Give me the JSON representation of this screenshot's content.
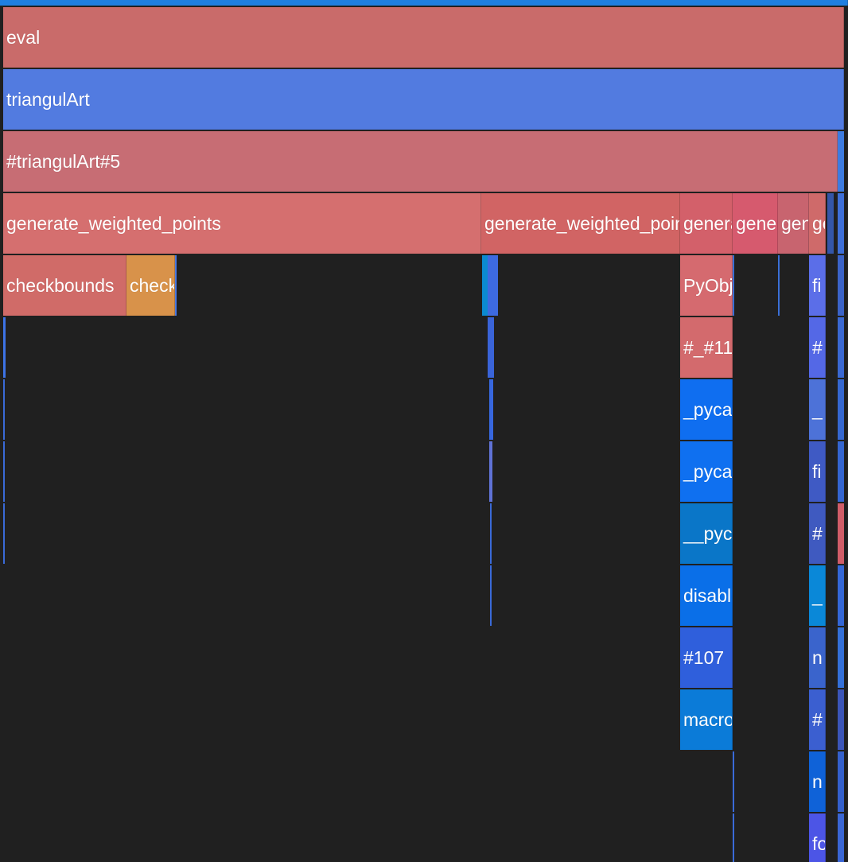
{
  "flamegraph": {
    "rows": [
      {
        "frames": [
          {
            "label": "",
            "start": 0,
            "end": 1066,
            "color": "#1f7fe0"
          }
        ]
      },
      {
        "frames": [
          {
            "label": "eval",
            "start": 4,
            "end": 1061,
            "color": "#c96b6a"
          }
        ]
      },
      {
        "frames": [
          {
            "label": "triangulArt",
            "start": 4,
            "end": 1061,
            "color": "#527be0"
          }
        ]
      },
      {
        "frames": [
          {
            "label": "#triangulArt#5",
            "start": 4,
            "end": 1053,
            "color": "#c76d74"
          },
          {
            "label": "",
            "start": 1053,
            "end": 1061,
            "color": "#3d7be0"
          }
        ]
      },
      {
        "frames": [
          {
            "label": "generate_weighted_points",
            "start": 4,
            "end": 605,
            "color": "#d56f6f"
          },
          {
            "label": "generate_weighted_points",
            "start": 605,
            "end": 855,
            "color": "#d16464"
          },
          {
            "label": "generate_weighted_points",
            "start": 855,
            "end": 921,
            "color": "#d3606a"
          },
          {
            "label": "generate_weighted_points",
            "start": 921,
            "end": 978,
            "color": "#d65a6e"
          },
          {
            "label": "generate_weighted_points",
            "start": 978,
            "end": 1017,
            "color": "#c8646f"
          },
          {
            "label": "generate_weighted_points",
            "start": 1017,
            "end": 1038,
            "color": "#cf6a6a"
          },
          {
            "label": "",
            "start": 1040,
            "end": 1048,
            "color": "#3456a8"
          },
          {
            "label": "",
            "start": 1053,
            "end": 1061,
            "color": "#3e6fd8"
          }
        ]
      },
      {
        "frames": [
          {
            "label": "checkbounds",
            "start": 4,
            "end": 159,
            "color": "#d06b68"
          },
          {
            "label": "checkbounds",
            "start": 159,
            "end": 220,
            "color": "#d8924a"
          },
          {
            "label": "",
            "start": 220,
            "end": 222,
            "color": "#4a78e0"
          },
          {
            "label": "",
            "start": 606,
            "end": 613,
            "color": "#0b8ad0"
          },
          {
            "label": "",
            "start": 613,
            "end": 626,
            "color": "#3d6ae0"
          },
          {
            "label": "PyObject",
            "start": 855,
            "end": 921,
            "color": "#d56a6f"
          },
          {
            "label": "",
            "start": 921,
            "end": 923,
            "color": "#3a6fd6"
          },
          {
            "label": "",
            "start": 978,
            "end": 980,
            "color": "#3a6fd6"
          },
          {
            "label": "fi",
            "start": 1017,
            "end": 1038,
            "color": "#5b6ee8"
          },
          {
            "label": "",
            "start": 1053,
            "end": 1061,
            "color": "#3b63c8"
          }
        ]
      },
      {
        "frames": [
          {
            "label": "",
            "start": 4,
            "end": 7,
            "color": "#3d73e6"
          },
          {
            "label": "",
            "start": 613,
            "end": 621,
            "color": "#3a64d8"
          },
          {
            "label": "#_#11",
            "start": 855,
            "end": 921,
            "color": "#d36a6d"
          },
          {
            "label": "#",
            "start": 1017,
            "end": 1038,
            "color": "#5468e6"
          },
          {
            "label": "",
            "start": 1053,
            "end": 1061,
            "color": "#3a68d2"
          }
        ]
      },
      {
        "frames": [
          {
            "label": "",
            "start": 4,
            "end": 6,
            "color": "#3a6ad8"
          },
          {
            "label": "",
            "start": 615,
            "end": 620,
            "color": "#3767de"
          },
          {
            "label": "_pycall",
            "start": 855,
            "end": 921,
            "color": "#0f6ef0"
          },
          {
            "label": "_",
            "start": 1017,
            "end": 1038,
            "color": "#4d72d8"
          },
          {
            "label": "",
            "start": 1053,
            "end": 1061,
            "color": "#3567d0"
          }
        ]
      },
      {
        "frames": [
          {
            "label": "",
            "start": 4,
            "end": 6,
            "color": "#3a6ad8"
          },
          {
            "label": "",
            "start": 615,
            "end": 619,
            "color": "#5f72d6"
          },
          {
            "label": "_pycall",
            "start": 855,
            "end": 921,
            "color": "#0f70f0"
          },
          {
            "label": "fi",
            "start": 1017,
            "end": 1038,
            "color": "#3f5ac4"
          },
          {
            "label": "",
            "start": 1053,
            "end": 1061,
            "color": "#3465d0"
          }
        ]
      },
      {
        "frames": [
          {
            "label": "",
            "start": 4,
            "end": 6,
            "color": "#3a6ad8"
          },
          {
            "label": "",
            "start": 616,
            "end": 618,
            "color": "#3a6ad8"
          },
          {
            "label": "__pycall",
            "start": 855,
            "end": 921,
            "color": "#0a76c8"
          },
          {
            "label": "#",
            "start": 1017,
            "end": 1038,
            "color": "#3f5ac0"
          },
          {
            "label": "",
            "start": 1053,
            "end": 1061,
            "color": "#d05d68"
          }
        ]
      },
      {
        "frames": [
          {
            "label": "",
            "start": 616,
            "end": 618,
            "color": "#3a6ad8"
          },
          {
            "label": "disable",
            "start": 855,
            "end": 921,
            "color": "#0a6fe8"
          },
          {
            "label": "_",
            "start": 1017,
            "end": 1038,
            "color": "#0a88d8"
          },
          {
            "label": "",
            "start": 1053,
            "end": 1061,
            "color": "#3467d6"
          }
        ]
      },
      {
        "frames": [
          {
            "label": "#107",
            "start": 855,
            "end": 921,
            "color": "#2f5fdc"
          },
          {
            "label": "n",
            "start": 1017,
            "end": 1038,
            "color": "#3a64cc"
          },
          {
            "label": "",
            "start": 1053,
            "end": 1061,
            "color": "#3470d8"
          }
        ]
      },
      {
        "frames": [
          {
            "label": "macro",
            "start": 855,
            "end": 921,
            "color": "#0b7bd8"
          },
          {
            "label": "#",
            "start": 1017,
            "end": 1038,
            "color": "#3b5fd0"
          },
          {
            "label": "",
            "start": 1053,
            "end": 1061,
            "color": "#3b55b8"
          }
        ]
      },
      {
        "frames": [
          {
            "label": "",
            "start": 921,
            "end": 923,
            "color": "#3a6ad8"
          },
          {
            "label": "n",
            "start": 1017,
            "end": 1038,
            "color": "#0f62d8"
          },
          {
            "label": "",
            "start": 1053,
            "end": 1061,
            "color": "#3460cc"
          }
        ]
      },
      {
        "frames": [
          {
            "label": "",
            "start": 921,
            "end": 923,
            "color": "#3a6ad8"
          },
          {
            "label": "fo",
            "start": 1017,
            "end": 1038,
            "color": "#4c55e6"
          },
          {
            "label": "",
            "start": 1053,
            "end": 1061,
            "color": "#3a66d4"
          }
        ]
      }
    ]
  }
}
